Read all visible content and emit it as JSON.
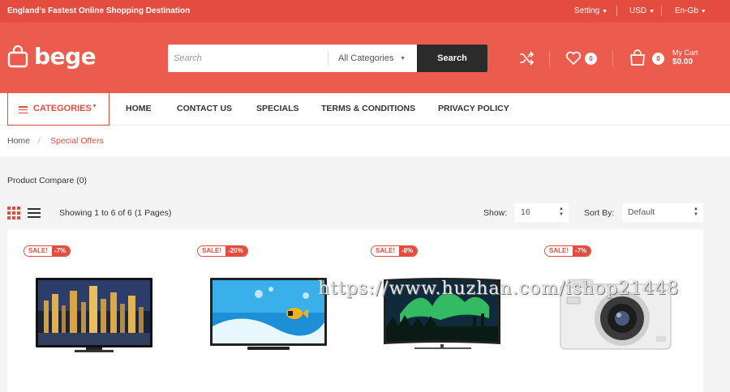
{
  "topbar": {
    "tagline": "England's Fastest Online Shopping Destination",
    "setting_label": "Setting",
    "currency_label": "USD",
    "language_label": "En-Gb"
  },
  "header": {
    "logo_text": "bege",
    "search": {
      "placeholder": "Search",
      "category_value": "All Categories",
      "button_label": "Search"
    },
    "wishlist_count": "0",
    "cart_count": "0",
    "cart_label": "My Cart",
    "cart_total": "$0.00"
  },
  "nav": {
    "categories_label": "CATEGORIES",
    "links": [
      "HOME",
      "CONTACT US",
      "SPECIALS",
      "TERMS & CONDITIONS",
      "PRIVACY POLICY"
    ]
  },
  "breadcrumb": {
    "home": "Home",
    "separator": "/",
    "current": "Special Offers"
  },
  "compare_text": "Product Compare (0)",
  "toolbar": {
    "showing_text": "Showing 1 to 6 of 6 (1 Pages)",
    "show_label": "Show:",
    "show_value": "16",
    "sort_label": "Sort By:",
    "sort_value": "Default"
  },
  "products": [
    {
      "sale_label": "SALE!",
      "discount": "-7%"
    },
    {
      "sale_label": "SALE!",
      "discount": "-20%"
    },
    {
      "sale_label": "SALE!",
      "discount": "-8%"
    },
    {
      "sale_label": "SALE!",
      "discount": "-7%"
    }
  ],
  "watermark": "https://www.huzhan.com/ishop21448",
  "colors": {
    "accent": "#e34c3f",
    "header_bg": "#ec5c4e",
    "dark_button": "#2b2b2b"
  }
}
